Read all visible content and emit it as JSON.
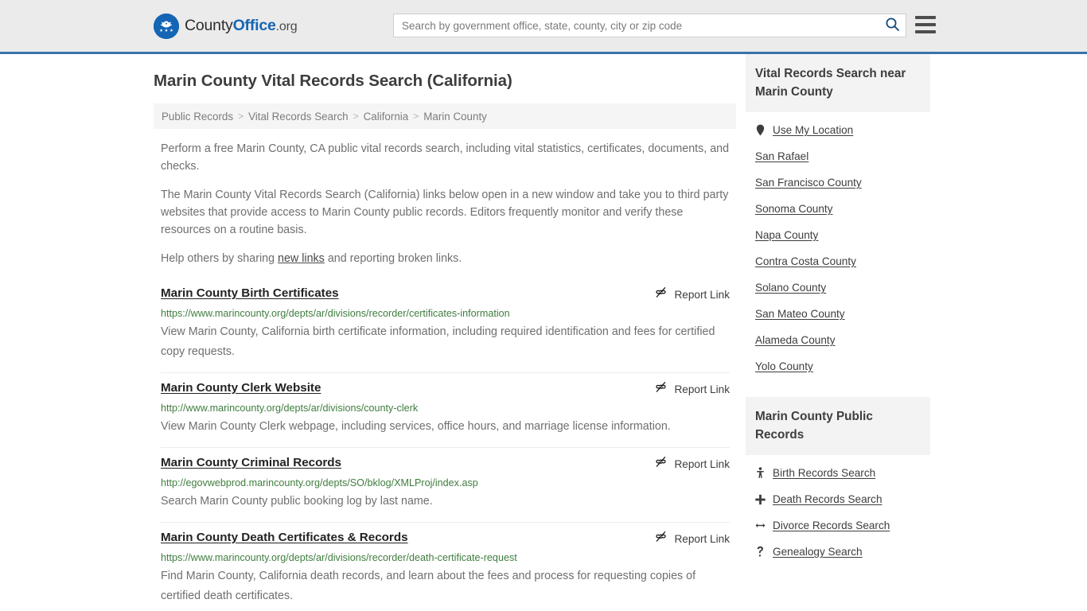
{
  "header": {
    "logo": {
      "icon": "eagle-seal-icon",
      "text_part1": "County",
      "text_part2": "Office",
      "text_part3": ".org"
    },
    "search": {
      "placeholder": "Search by government office, state, county, city or zip code",
      "value": "",
      "search_icon": "search-icon"
    },
    "menu_icon": "hamburger-menu-icon"
  },
  "main": {
    "page_title": "Marin County Vital Records Search (California)",
    "breadcrumb": [
      "Public Records",
      "Vital Records Search",
      "California",
      "Marin County"
    ],
    "breadcrumb_separator": ">",
    "intro_paragraph_1": "Perform a free Marin County, CA public vital records search, including vital statistics, certificates, documents, and checks.",
    "intro_paragraph_2": "The Marin County Vital Records Search (California) links below open in a new window and take you to third party websites that provide access to Marin County public records. Editors frequently monitor and verify these resources on a routine basis.",
    "intro_paragraph_3_before": "Help others by sharing ",
    "intro_paragraph_3_link": "new links",
    "intro_paragraph_3_after": " and reporting broken links.",
    "report_link_label": "Report Link",
    "report_link_icon": "broken-link-icon",
    "results": [
      {
        "title": "Marin County Birth Certificates",
        "url": "https://www.marincounty.org/depts/ar/divisions/recorder/certificates-information",
        "description": "View Marin County, California birth certificate information, including required identification and fees for certified copy requests."
      },
      {
        "title": "Marin County Clerk Website",
        "url": "http://www.marincounty.org/depts/ar/divisions/county-clerk",
        "description": "View Marin County Clerk webpage, including services, office hours, and marriage license information."
      },
      {
        "title": "Marin County Criminal Records",
        "url": "http://egovwebprod.marincounty.org/depts/SO/bklog/XMLProj/index.asp",
        "description": "Search Marin County public booking log by last name."
      },
      {
        "title": "Marin County Death Certificates & Records",
        "url": "https://www.marincounty.org/depts/ar/divisions/recorder/death-certificate-request",
        "description": "Find Marin County, California death records, and learn about the fees and process for requesting copies of certified death certificates."
      }
    ]
  },
  "sidebar": {
    "nearby_heading": "Vital Records Search near Marin County",
    "nearby_items": [
      {
        "label": "Use My Location",
        "icon": "map-pin-icon"
      },
      {
        "label": "San Rafael",
        "icon": ""
      },
      {
        "label": "San Francisco County",
        "icon": ""
      },
      {
        "label": "Sonoma County",
        "icon": ""
      },
      {
        "label": "Napa County",
        "icon": ""
      },
      {
        "label": "Contra Costa County",
        "icon": ""
      },
      {
        "label": "Solano County",
        "icon": ""
      },
      {
        "label": "San Mateo County",
        "icon": ""
      },
      {
        "label": "Alameda County",
        "icon": ""
      },
      {
        "label": "Yolo County",
        "icon": ""
      }
    ],
    "public_records_heading": "Marin County Public Records",
    "public_records_items": [
      {
        "label": "Birth Records Search",
        "icon": "baby-icon"
      },
      {
        "label": "Death Records Search",
        "icon": "cross-icon"
      },
      {
        "label": "Divorce Records Search",
        "icon": "split-arrows-icon"
      },
      {
        "label": "Genealogy Search",
        "icon": "family-tree-icon"
      }
    ]
  },
  "colors": {
    "brand_blue": "#1565b5",
    "header_border": "#3a73a8",
    "header_bg": "#ebebeb",
    "url_green": "#3f7d3f",
    "body_text": "#6f6f6f"
  }
}
